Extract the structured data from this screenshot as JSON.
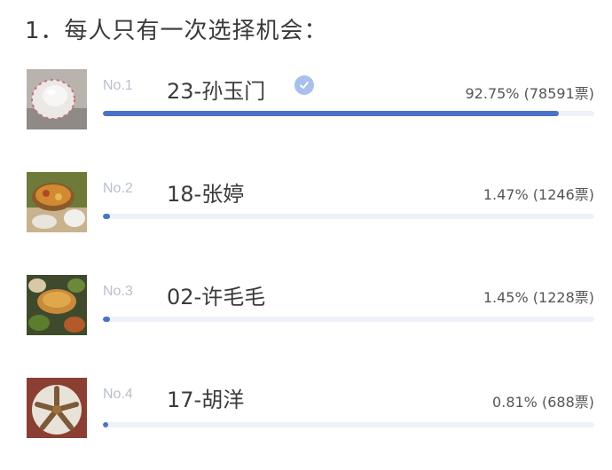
{
  "question": {
    "title": "1．每人只有一次选择机会："
  },
  "options": [
    {
      "rank": "No.1",
      "name": "23-孙玉门",
      "percent": "92.75%",
      "votes": "(78591票)",
      "fraction": 0.9275,
      "selected": true
    },
    {
      "rank": "No.2",
      "name": "18-张婷",
      "percent": "1.47%",
      "votes": "(1246票)",
      "fraction": 0.0147,
      "selected": false
    },
    {
      "rank": "No.3",
      "name": "02-许毛毛",
      "percent": "1.45%",
      "votes": "(1228票)",
      "fraction": 0.0145,
      "selected": false
    },
    {
      "rank": "No.4",
      "name": "17-胡洋",
      "percent": "0.81%",
      "votes": "(688票)",
      "fraction": 0.0081,
      "selected": false
    }
  ],
  "colors": {
    "bar_fill": "#4a72c6",
    "bar_track": "#eef1f7",
    "check_badge": "#a8c0ea",
    "rank_text": "#b9c0ca"
  },
  "icons": {
    "selected_marker": "check-circle-icon"
  }
}
